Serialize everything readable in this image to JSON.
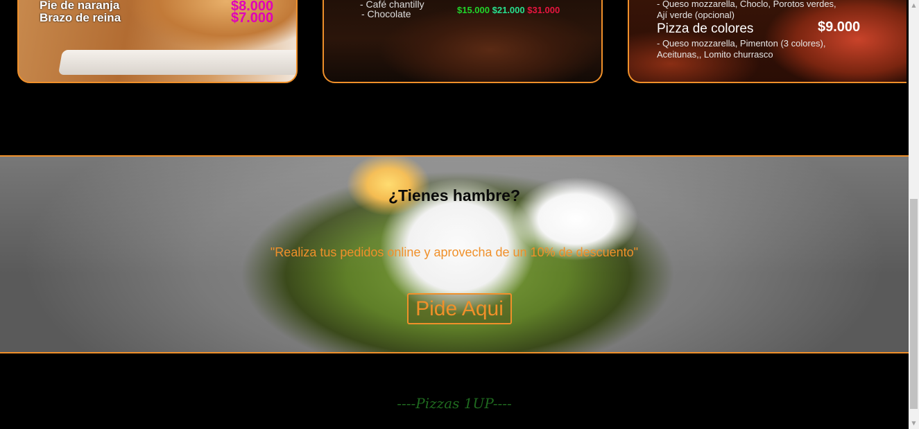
{
  "cards": [
    {
      "lines": [
        "Pie de naranja",
        "Brazo de reina"
      ],
      "prices": [
        "$8.000",
        "$7.000"
      ]
    },
    {
      "lines": [
        "- Café chantilly",
        "- Chocolate"
      ],
      "prices": [
        "$15.000",
        "$21.000",
        "$31.000"
      ]
    },
    {
      "top_desc": "- Queso mozzarella,  Choclo, Porotos verdes, Ají verde (opcional)",
      "title": "Pizza de colores",
      "price": "$9.000",
      "desc": "- Queso mozzarella, Pimenton (3 colores), Aceitunas,, Lomito churrasco"
    }
  ],
  "banner": {
    "title": "¿Tienes hambre?",
    "quote": "\"Realiza tus pedidos online y aprovecha de un 10% de descuento\"",
    "cta_label": "Pide Aqui"
  },
  "section": {
    "heading": "----Pizzas 1UP----"
  },
  "colors": {
    "accent": "#f0902a",
    "heading_green": "#1f6a1f",
    "background": "#000000"
  }
}
